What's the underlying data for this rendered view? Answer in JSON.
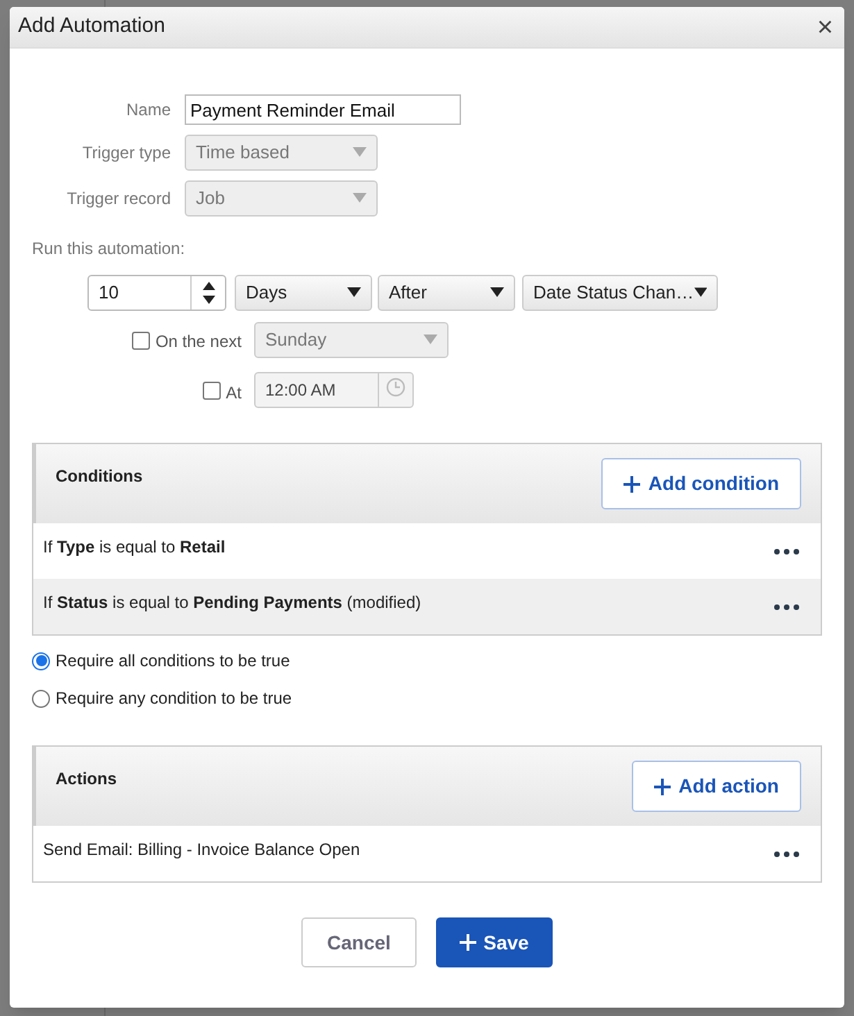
{
  "dialog": {
    "title": "Add Automation",
    "close": "×"
  },
  "fields": [
    {
      "kind": "text",
      "label": "Name",
      "value": "Payment Reminder Email",
      "disabled": false
    },
    {
      "kind": "select",
      "label": "Trigger type",
      "value": "Time based",
      "disabled": true
    },
    {
      "kind": "select",
      "label": "Trigger record",
      "value": "Job",
      "disabled": true
    }
  ],
  "run": {
    "label": "Run this automation:",
    "amount": "10",
    "unit": "Days",
    "relation": "After",
    "date_field": "Date Status Chan…",
    "on_the_next": {
      "label": "On the next",
      "checked": false,
      "value": "Sunday"
    },
    "at": {
      "label": "At",
      "checked": false,
      "value": "12:00 AM"
    }
  },
  "conditions": {
    "title": "Conditions",
    "add_button": "Add condition",
    "rows": [
      {
        "text": "If **Type** is equal to **Retail**"
      },
      {
        "text": "If **Status** is equal to **Pending Payments** (modified)"
      }
    ]
  },
  "require": [
    {
      "label": "Require all conditions to be true",
      "selected": true
    },
    {
      "label": "Require any condition to be true",
      "selected": false
    }
  ],
  "actions": {
    "title": "Actions",
    "add_button": "Add action",
    "rows": [
      {
        "text": "Send Email: Billing - Invoice Balance Open"
      }
    ]
  },
  "buttons": [
    {
      "kind": "secondary",
      "label": "Cancel"
    },
    {
      "kind": "primary",
      "label": "Save"
    }
  ]
}
